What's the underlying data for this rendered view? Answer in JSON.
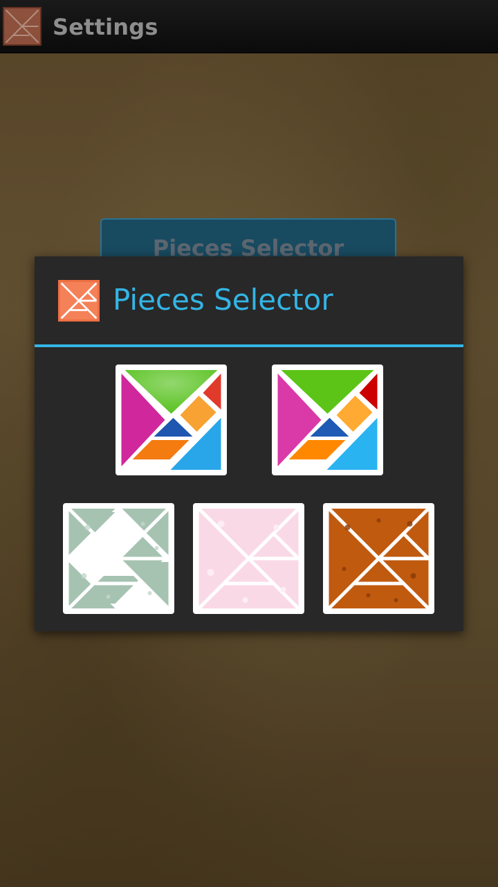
{
  "actionbar": {
    "title": "Settings",
    "icon": "tangram-app-icon"
  },
  "background_button": {
    "label": "Pieces Selector"
  },
  "dialog": {
    "title": "Pieces Selector",
    "icon": "tangram-app-icon",
    "accent": "#33b5e5",
    "options": [
      {
        "name": "colorful-glossy",
        "colors": {
          "top": "#58c21f",
          "left": "#d0279c",
          "topright": "#e03a2a",
          "square": "#f7a233",
          "small": "#1f56b0",
          "para": "#f47b10",
          "right": "#29a6ea"
        }
      },
      {
        "name": "colorful-flat",
        "colors": {
          "top": "#5cc417",
          "left": "#d93aa8",
          "topright": "#cc0000",
          "square": "#ffaa33",
          "small": "#1f5ab5",
          "para": "#ff8800",
          "right": "#2ab3f1"
        }
      },
      {
        "name": "green-pattern",
        "colors": {
          "fill": "#a6c3b2"
        }
      },
      {
        "name": "pink-pattern",
        "colors": {
          "fill": "#fad9e6"
        }
      },
      {
        "name": "orange-pattern",
        "colors": {
          "fill": "#c05a0f"
        }
      }
    ]
  }
}
